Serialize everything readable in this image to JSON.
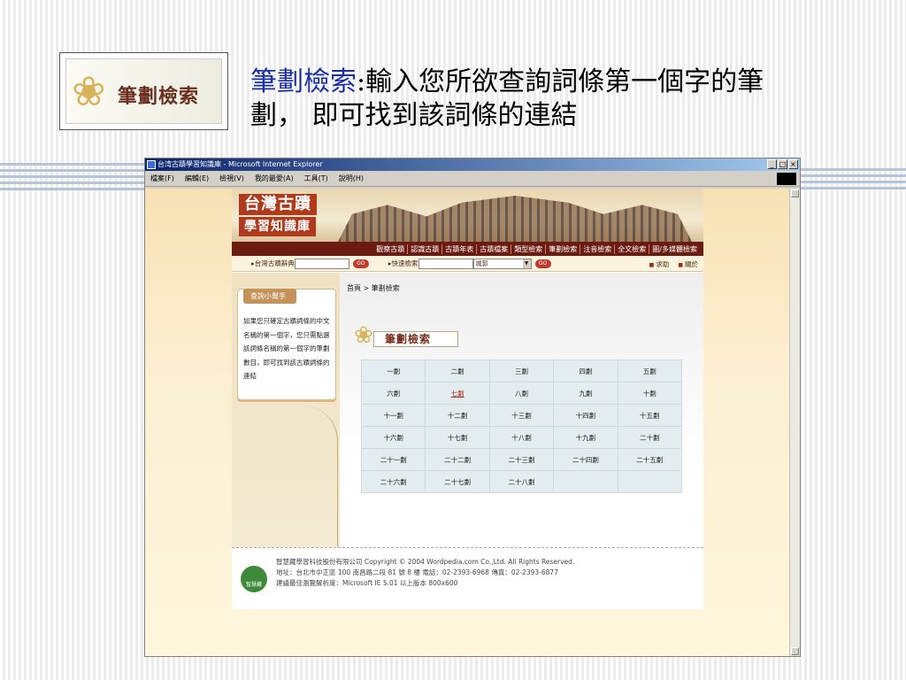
{
  "slide": {
    "logo_text": "筆劃檢索",
    "title_keyword": "筆劃檢索",
    "title_rest_line1": ":輸入您所欲查詢詞條第一個字的筆",
    "title_line2": "劃， 即可找到該詞條的連結"
  },
  "window": {
    "title": "台湾古蹟學習知識庫 - Microsoft Internet Explorer",
    "controls": [
      "_",
      "□",
      "×"
    ],
    "menu": [
      "檔案(F)",
      "編輯(E)",
      "檢視(V)",
      "我的最愛(A)",
      "工具(T)",
      "說明(H)"
    ]
  },
  "site": {
    "logo_line1": "台灣古蹟",
    "logo_line2": "學習知識庫",
    "nav": [
      "觀察古蹟",
      "認識古蹟",
      "古蹟年表",
      "古蹟檔案",
      "類型檢索",
      "筆劃檢索",
      "注音檢索",
      "全文檢索",
      "圖/多媒體檢索"
    ],
    "search": {
      "dict_label": "台灣古蹟辭典",
      "go_label": "GO",
      "quick_label": "快速檢索",
      "select_value": "城郭",
      "links": [
        "求助",
        "關於"
      ]
    },
    "help": {
      "title": "查詢小幫手",
      "body": "如果您只確定古蹟詞條的中文名稱的第一個字，您只需點選該詞條名稱的第一個字的筆劃數目，即可找到該古蹟詞條的連結"
    },
    "breadcrumb": "首頁 > 筆劃檢索",
    "section_title": "筆劃檢索",
    "strokes": [
      "一劃",
      "二劃",
      "三劃",
      "四劃",
      "五劃",
      "六劃",
      "七劃",
      "八劃",
      "九劃",
      "十劃",
      "十一劃",
      "十二劃",
      "十三劃",
      "十四劃",
      "十五劃",
      "十六劃",
      "十七劃",
      "十八劃",
      "十九劃",
      "二十劃",
      "二十一劃",
      "二十二劃",
      "二十三劃",
      "二十四劃",
      "二十五劃",
      "二十六劃",
      "二十七劃",
      "二十八劃"
    ],
    "active_stroke": "七劃",
    "footer": {
      "logo": "智慧藏",
      "line1": "智慧藏學習科技股份有限公司 Copyright © 2004 Wordpedia.com Co.,Ltd. All Rights Reserved.",
      "line2": "地址：台北市中正區 100 南昌路二段 81 號 8 樓 電話：02-2393-6968 傳真：02-2393-6877",
      "line3": "建議最佳瀏覽解析度：Microsoft IE 5.01 以上版本 800x600"
    }
  }
}
